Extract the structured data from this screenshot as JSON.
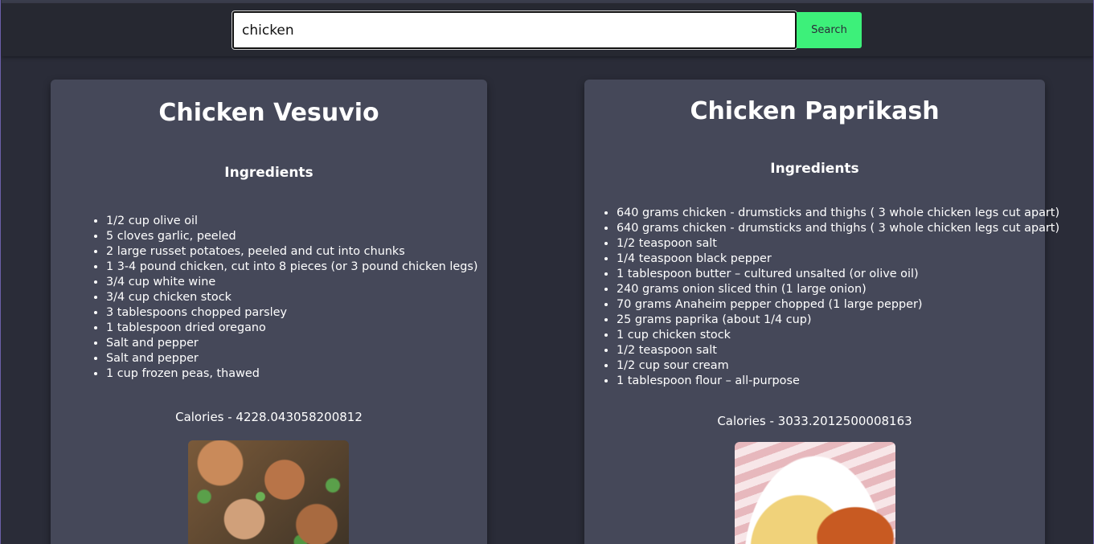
{
  "search": {
    "value": "chicken",
    "button_label": "Search"
  },
  "recipes": [
    {
      "title": "Chicken Vesuvio",
      "ingredients_heading": "Ingredients",
      "ingredients": [
        "1/2 cup olive oil",
        "5 cloves garlic, peeled",
        "2 large russet potatoes, peeled and cut into chunks",
        "1 3-4 pound chicken, cut into 8 pieces (or 3 pound chicken legs)",
        "3/4 cup white wine",
        "3/4 cup chicken stock",
        "3 tablespoons chopped parsley",
        "1 tablespoon dried oregano",
        "Salt and pepper",
        "Salt and pepper",
        "1 cup frozen peas, thawed"
      ],
      "calories": "Calories - 4228.043058200812",
      "image": "chicken-vesuvio-photo"
    },
    {
      "title": "Chicken Paprikash",
      "ingredients_heading": "Ingredients",
      "ingredients": [
        "640 grams chicken - drumsticks and thighs ( 3 whole chicken legs cut apart)",
        "640 grams chicken - drumsticks and thighs ( 3 whole chicken legs cut apart)",
        "1/2 teaspoon salt",
        "1/4 teaspoon black pepper",
        "1 tablespoon butter – cultured unsalted (or olive oil)",
        "240 grams onion sliced thin (1 large onion)",
        "70 grams Anaheim pepper chopped (1 large pepper)",
        "25 grams paprika (about 1/4 cup)",
        "1 cup chicken stock",
        "1/2 teaspoon salt",
        "1/2 cup sour cream",
        "1 tablespoon flour – all-purpose"
      ],
      "calories": "Calories - 3033.2012500008163",
      "image": "chicken-paprikash-photo"
    }
  ]
}
